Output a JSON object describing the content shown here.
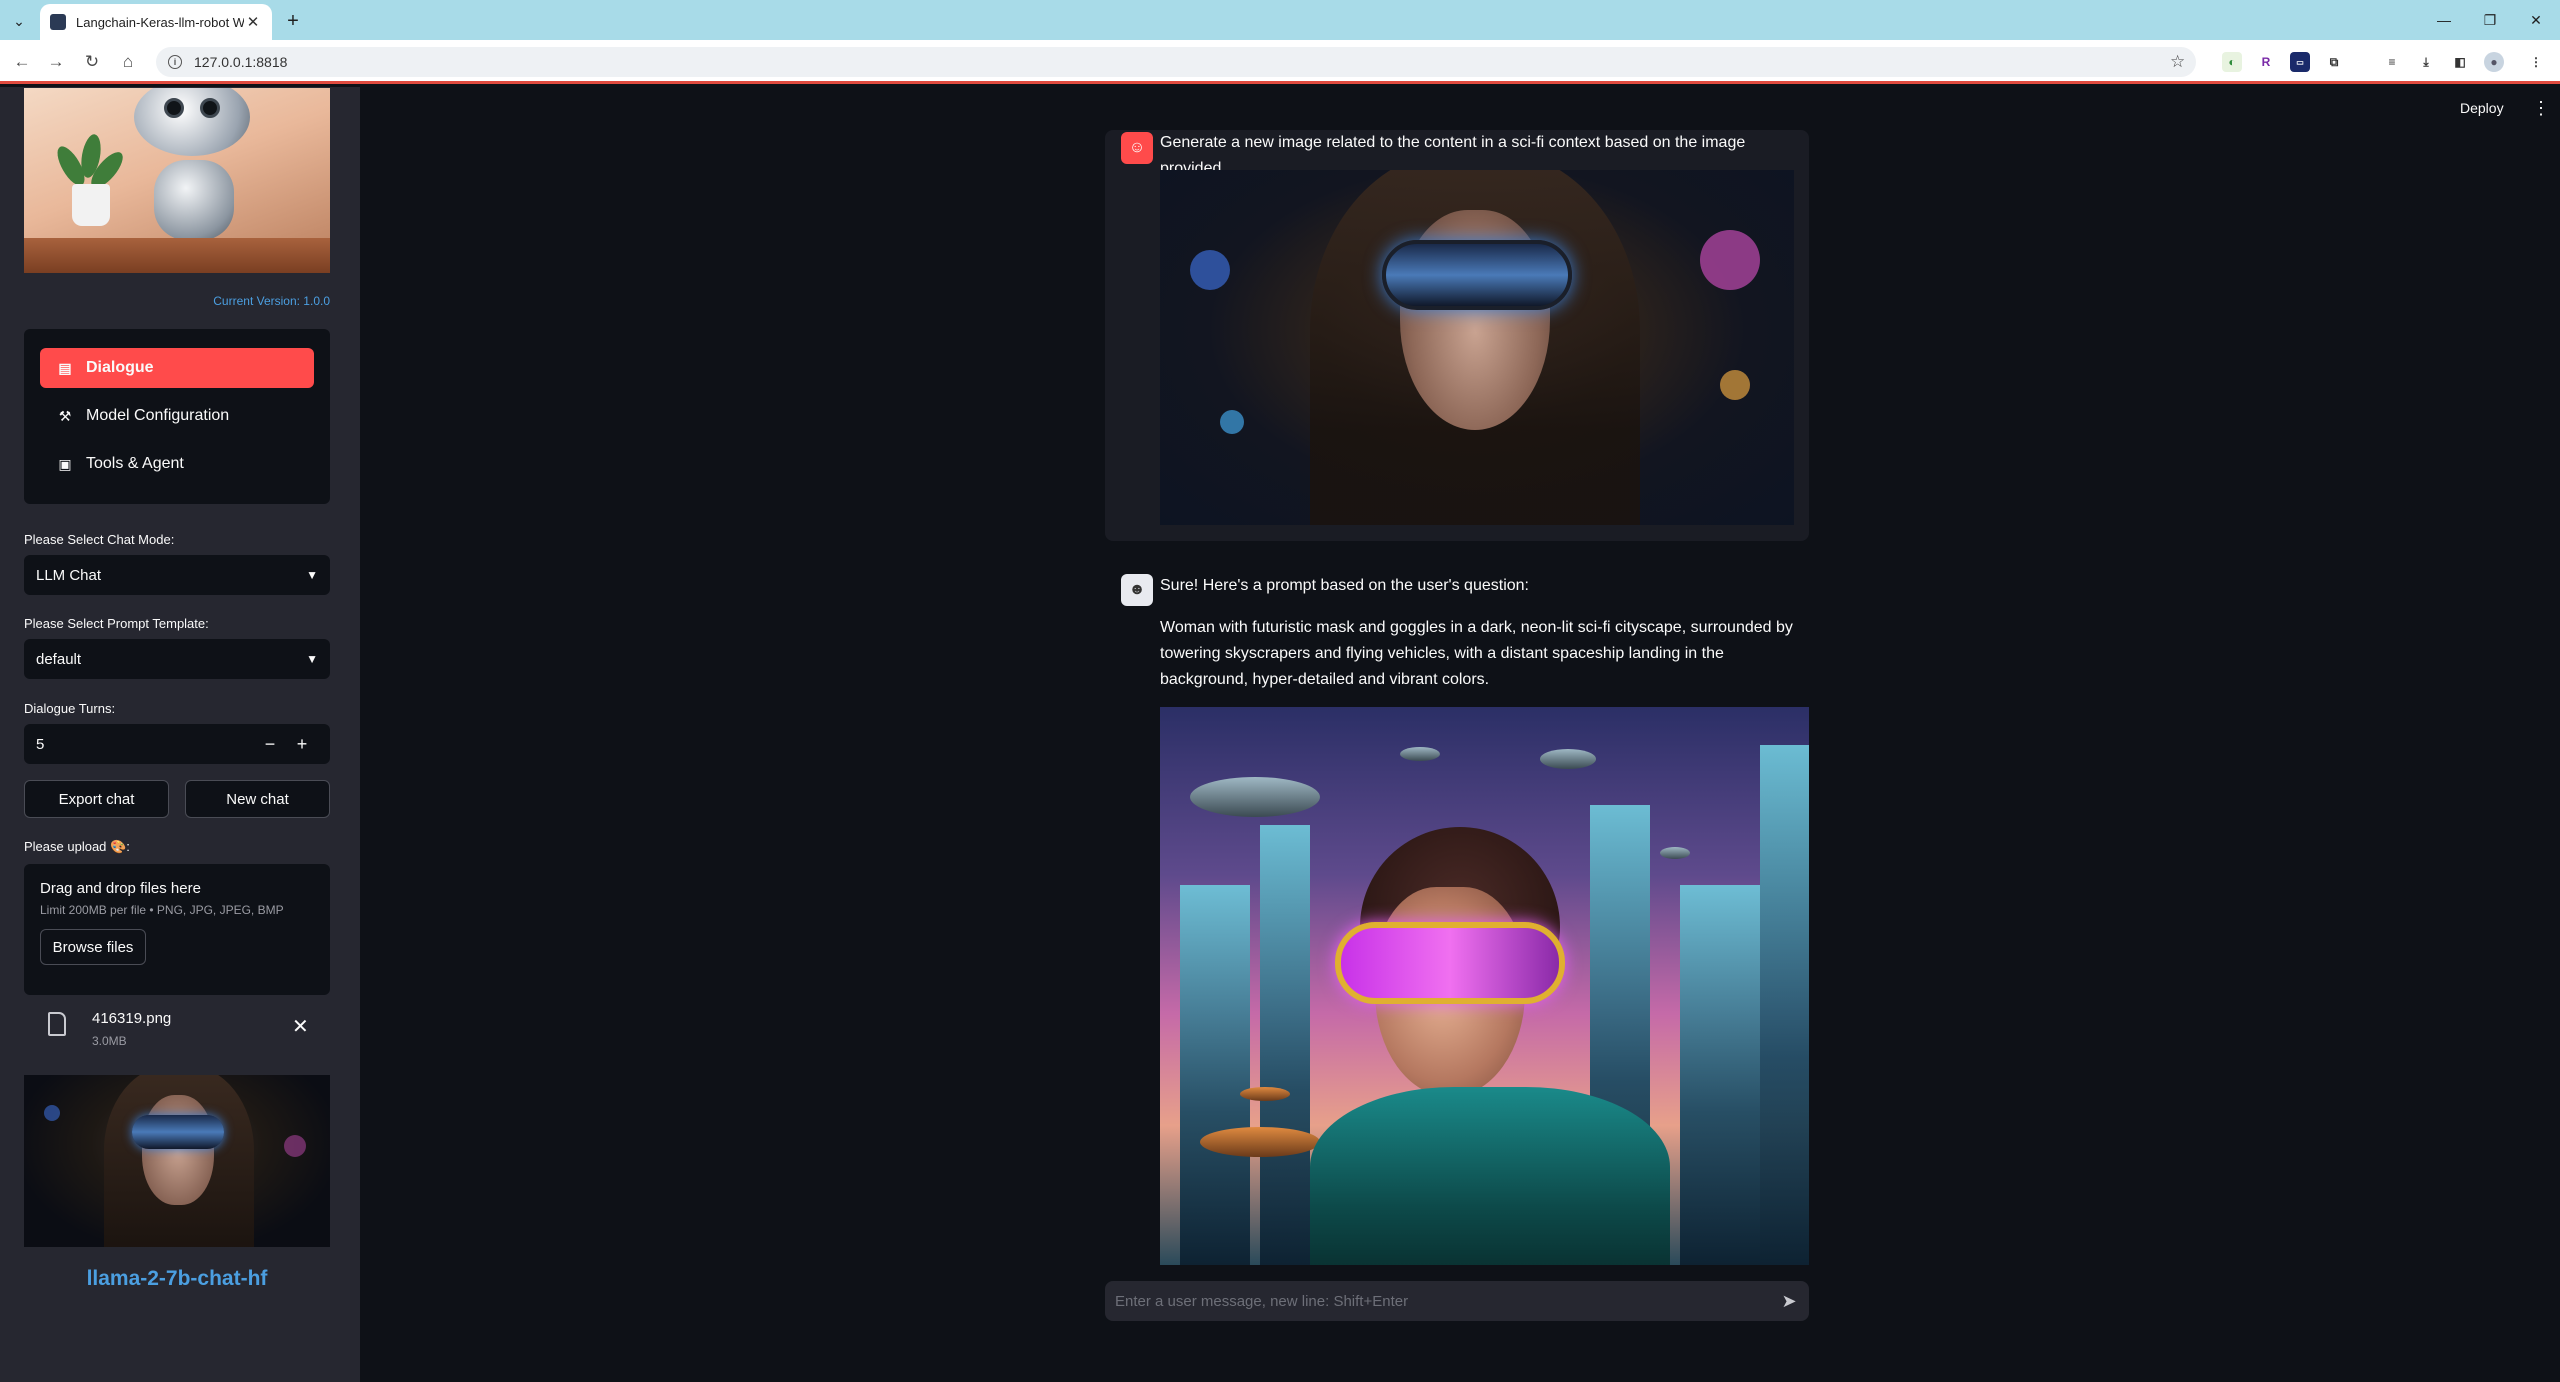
{
  "browser": {
    "tab_title": "Langchain-Keras-llm-robot We",
    "url": "127.0.0.1:8818"
  },
  "sidebar": {
    "version_text": "Current Version: 1.0.0",
    "menu": [
      {
        "label": "Dialogue",
        "icon": "chat-bubble-icon",
        "active": true
      },
      {
        "label": "Model Configuration",
        "icon": "magic-wand-icon",
        "active": false
      },
      {
        "label": "Tools & Agent",
        "icon": "archive-box-icon",
        "active": false
      }
    ],
    "chat_mode_label": "Please Select Chat Mode:",
    "chat_mode_value": "LLM Chat",
    "prompt_template_label": "Please Select Prompt Template:",
    "prompt_template_value": "default",
    "dialogue_turns_label": "Dialogue Turns:",
    "dialogue_turns_value": "5",
    "stepper_minus": "−",
    "stepper_plus": "+",
    "export_label": "Export chat",
    "new_chat_label": "New chat",
    "upload_label": "Please upload 🎨:",
    "uploader_title": "Drag and drop files here",
    "uploader_limit": "Limit 200MB per file • PNG, JPG, JPEG, BMP",
    "browse_label": "Browse files",
    "file_name": "416319.png",
    "file_size": "3.0MB",
    "model_name": "llama-2-7b-chat-hf"
  },
  "header": {
    "deploy_label": "Deploy",
    "kebab_glyph": "⋮"
  },
  "chat": {
    "user_message": "Generate a new image related to the content in a sci-fi context based on the image provided.",
    "bot_intro": "Sure! Here's a prompt based on the user's question:",
    "bot_prompt": "Woman with futuristic mask and goggles in a dark, neon-lit sci-fi cityscape, surrounded by towering skyscrapers and flying vehicles, with a distant spaceship landing in the background, hyper-detailed and vibrant colors.",
    "input_placeholder": "Enter a user message, new line: Shift+Enter"
  },
  "colors": {
    "accent": "#ff4b4b",
    "link": "#4b9fe1",
    "background": "#0e1117",
    "sidebar": "#262730"
  }
}
